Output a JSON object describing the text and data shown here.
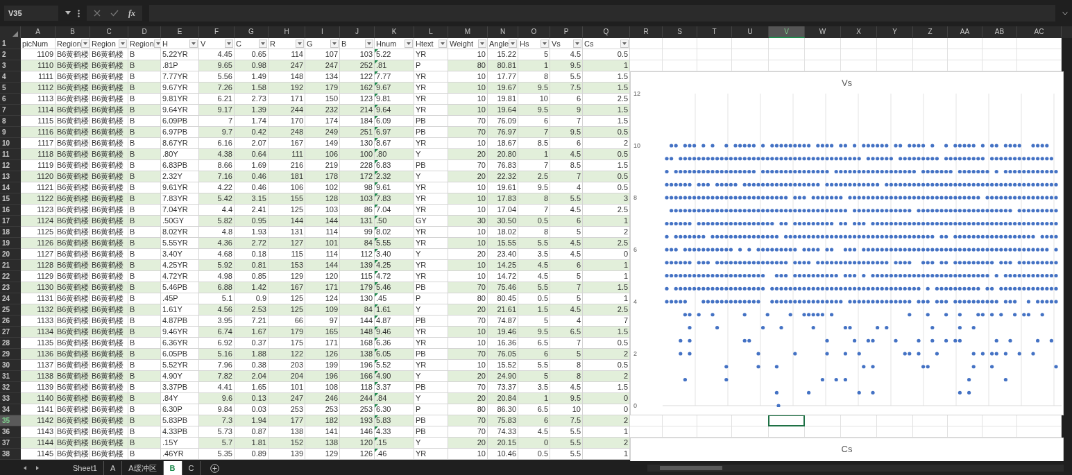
{
  "name_box": {
    "value": "V35"
  },
  "formula_bar": {
    "function_label": "fx"
  },
  "columns": [
    {
      "letter": "A",
      "selected": false
    },
    {
      "letter": "B",
      "selected": false
    },
    {
      "letter": "C",
      "selected": false
    },
    {
      "letter": "D",
      "selected": false
    },
    {
      "letter": "E",
      "selected": false
    },
    {
      "letter": "F",
      "selected": false
    },
    {
      "letter": "G",
      "selected": false
    },
    {
      "letter": "H",
      "selected": false
    },
    {
      "letter": "I",
      "selected": false
    },
    {
      "letter": "J",
      "selected": false
    },
    {
      "letter": "K",
      "selected": false
    },
    {
      "letter": "L",
      "selected": false
    },
    {
      "letter": "M",
      "selected": false
    },
    {
      "letter": "N",
      "selected": false
    },
    {
      "letter": "O",
      "selected": false
    },
    {
      "letter": "P",
      "selected": false
    },
    {
      "letter": "Q",
      "selected": false
    },
    {
      "letter": "R",
      "selected": false
    },
    {
      "letter": "S",
      "selected": false
    },
    {
      "letter": "T",
      "selected": false
    },
    {
      "letter": "U",
      "selected": false
    },
    {
      "letter": "V",
      "selected": true
    },
    {
      "letter": "W",
      "selected": false
    },
    {
      "letter": "X",
      "selected": false
    },
    {
      "letter": "Y",
      "selected": false
    },
    {
      "letter": "Z",
      "selected": false
    },
    {
      "letter": "AA",
      "selected": false
    },
    {
      "letter": "AB",
      "selected": false
    },
    {
      "letter": "AC",
      "selected": false
    }
  ],
  "header_row": {
    "num": "1",
    "headers": [
      {
        "text": "picNum",
        "filter": false,
        "kind": "number",
        "banded": true
      },
      {
        "text": "Region",
        "filter": true,
        "kind": "text",
        "banded": true
      },
      {
        "text": "Region",
        "filter": true,
        "kind": "text",
        "banded": true
      },
      {
        "text": "Region",
        "filter": true,
        "kind": "text",
        "banded": true
      },
      {
        "text": "H",
        "filter": true,
        "kind": "text",
        "banded": false
      },
      {
        "text": "V",
        "filter": true,
        "kind": "number",
        "banded": true
      },
      {
        "text": "C",
        "filter": true,
        "kind": "number",
        "banded": true
      },
      {
        "text": "R",
        "filter": true,
        "kind": "number",
        "banded": true
      },
      {
        "text": "G",
        "filter": true,
        "kind": "number",
        "banded": true
      },
      {
        "text": "B",
        "filter": true,
        "kind": "number",
        "banded": true
      },
      {
        "text": "Hnum",
        "filter": true,
        "kind": "number_as_text",
        "banded": true
      },
      {
        "text": "Htext",
        "filter": true,
        "kind": "text",
        "banded": false
      },
      {
        "text": "Weight",
        "filter": true,
        "kind": "number",
        "banded": true
      },
      {
        "text": "Angle",
        "filter": true,
        "kind": "number",
        "banded": true
      },
      {
        "text": "Hs",
        "filter": true,
        "kind": "number",
        "banded": true
      },
      {
        "text": "Vs",
        "filter": true,
        "kind": "number",
        "banded": true
      },
      {
        "text": "Cs",
        "filter": true,
        "kind": "number",
        "banded": true
      }
    ]
  },
  "rows": [
    {
      "num": "2",
      "selected": false,
      "cells": [
        "1109",
        "B6黄鹤楼",
        "B6黄鹤楼",
        "B",
        "5.22YR",
        "4.45",
        "0.65",
        "114",
        "107",
        "103",
        "5.22",
        "YR",
        "10",
        "15.22",
        "5",
        "4.5",
        "0.5"
      ]
    },
    {
      "num": "3",
      "selected": false,
      "cells": [
        "1110",
        "B6黄鹤楼",
        "B6黄鹤楼",
        "B",
        ".81P",
        "9.65",
        "0.98",
        "247",
        "247",
        "252",
        ".81",
        "P",
        "80",
        "80.81",
        "1",
        "9.5",
        "1"
      ]
    },
    {
      "num": "4",
      "selected": false,
      "cells": [
        "1111",
        "B6黄鹤楼",
        "B6黄鹤楼",
        "B",
        "7.77YR",
        "5.56",
        "1.49",
        "148",
        "134",
        "122",
        "7.77",
        "YR",
        "10",
        "17.77",
        "8",
        "5.5",
        "1.5"
      ]
    },
    {
      "num": "5",
      "selected": false,
      "cells": [
        "1112",
        "B6黄鹤楼",
        "B6黄鹤楼",
        "B",
        "9.67YR",
        "7.26",
        "1.58",
        "192",
        "179",
        "162",
        "9.67",
        "YR",
        "10",
        "19.67",
        "9.5",
        "7.5",
        "1.5"
      ]
    },
    {
      "num": "6",
      "selected": false,
      "cells": [
        "1113",
        "B6黄鹤楼",
        "B6黄鹤楼",
        "B",
        "9.81YR",
        "6.21",
        "2.73",
        "171",
        "150",
        "123",
        "9.81",
        "YR",
        "10",
        "19.81",
        "10",
        "6",
        "2.5"
      ]
    },
    {
      "num": "7",
      "selected": false,
      "cells": [
        "1114",
        "B6黄鹤楼",
        "B6黄鹤楼",
        "B",
        "9.64YR",
        "9.17",
        "1.39",
        "244",
        "232",
        "214",
        "9.64",
        "YR",
        "10",
        "19.64",
        "9.5",
        "9",
        "1.5"
      ]
    },
    {
      "num": "8",
      "selected": false,
      "cells": [
        "1115",
        "B6黄鹤楼",
        "B6黄鹤楼",
        "B",
        "6.09PB",
        "7",
        "1.74",
        "170",
        "174",
        "184",
        "6.09",
        "PB",
        "70",
        "76.09",
        "6",
        "7",
        "1.5"
      ]
    },
    {
      "num": "9",
      "selected": false,
      "cells": [
        "1116",
        "B6黄鹤楼",
        "B6黄鹤楼",
        "B",
        "6.97PB",
        "9.7",
        "0.42",
        "248",
        "249",
        "251",
        "6.97",
        "PB",
        "70",
        "76.97",
        "7",
        "9.5",
        "0.5"
      ]
    },
    {
      "num": "10",
      "selected": false,
      "cells": [
        "1117",
        "B6黄鹤楼",
        "B6黄鹤楼",
        "B",
        "8.67YR",
        "6.16",
        "2.07",
        "167",
        "149",
        "130",
        "8.67",
        "YR",
        "10",
        "18.67",
        "8.5",
        "6",
        "2"
      ]
    },
    {
      "num": "11",
      "selected": false,
      "cells": [
        "1118",
        "B6黄鹤楼",
        "B6黄鹤楼",
        "B",
        ".80Y",
        "4.38",
        "0.64",
        "111",
        "106",
        "100",
        ".80",
        "Y",
        "20",
        "20.80",
        "1",
        "4.5",
        "0.5"
      ]
    },
    {
      "num": "12",
      "selected": false,
      "cells": [
        "1119",
        "B6黄鹤楼",
        "B6黄鹤楼",
        "B",
        "6.83PB",
        "8.66",
        "1.69",
        "216",
        "219",
        "228",
        "6.83",
        "PB",
        "70",
        "76.83",
        "7",
        "8.5",
        "1.5"
      ]
    },
    {
      "num": "13",
      "selected": false,
      "cells": [
        "1120",
        "B6黄鹤楼",
        "B6黄鹤楼",
        "B",
        "2.32Y",
        "7.16",
        "0.46",
        "181",
        "178",
        "172",
        "2.32",
        "Y",
        "20",
        "22.32",
        "2.5",
        "7",
        "0.5"
      ]
    },
    {
      "num": "14",
      "selected": false,
      "cells": [
        "1121",
        "B6黄鹤楼",
        "B6黄鹤楼",
        "B",
        "9.61YR",
        "4.22",
        "0.46",
        "106",
        "102",
        "98",
        "9.61",
        "YR",
        "10",
        "19.61",
        "9.5",
        "4",
        "0.5"
      ]
    },
    {
      "num": "15",
      "selected": false,
      "cells": [
        "1122",
        "B6黄鹤楼",
        "B6黄鹤楼",
        "B",
        "7.83YR",
        "5.42",
        "3.15",
        "155",
        "128",
        "103",
        "7.83",
        "YR",
        "10",
        "17.83",
        "8",
        "5.5",
        "3"
      ]
    },
    {
      "num": "16",
      "selected": false,
      "cells": [
        "1123",
        "B6黄鹤楼",
        "B6黄鹤楼",
        "B",
        "7.04YR",
        "4.4",
        "2.41",
        "125",
        "103",
        "86",
        "7.04",
        "YR",
        "10",
        "17.04",
        "7",
        "4.5",
        "2.5"
      ]
    },
    {
      "num": "17",
      "selected": false,
      "cells": [
        "1124",
        "B6黄鹤楼",
        "B6黄鹤楼",
        "B",
        ".50GY",
        "5.82",
        "0.95",
        "144",
        "144",
        "131",
        ".50",
        "GY",
        "30",
        "30.50",
        "0.5",
        "6",
        "1"
      ]
    },
    {
      "num": "18",
      "selected": false,
      "cells": [
        "1125",
        "B6黄鹤楼",
        "B6黄鹤楼",
        "B",
        "8.02YR",
        "4.8",
        "1.93",
        "131",
        "114",
        "99",
        "8.02",
        "YR",
        "10",
        "18.02",
        "8",
        "5",
        "2"
      ]
    },
    {
      "num": "19",
      "selected": false,
      "cells": [
        "1126",
        "B6黄鹤楼",
        "B6黄鹤楼",
        "B",
        "5.55YR",
        "4.36",
        "2.72",
        "127",
        "101",
        "84",
        "5.55",
        "YR",
        "10",
        "15.55",
        "5.5",
        "4.5",
        "2.5"
      ]
    },
    {
      "num": "20",
      "selected": false,
      "cells": [
        "1127",
        "B6黄鹤楼",
        "B6黄鹤楼",
        "B",
        "3.40Y",
        "4.68",
        "0.18",
        "115",
        "114",
        "112",
        "3.40",
        "Y",
        "20",
        "23.40",
        "3.5",
        "4.5",
        "0"
      ]
    },
    {
      "num": "21",
      "selected": false,
      "cells": [
        "1128",
        "B6黄鹤楼",
        "B6黄鹤楼",
        "B",
        "4.25YR",
        "5.92",
        "0.81",
        "153",
        "144",
        "139",
        "4.25",
        "YR",
        "10",
        "14.25",
        "4.5",
        "6",
        "1"
      ]
    },
    {
      "num": "22",
      "selected": false,
      "cells": [
        "1129",
        "B6黄鹤楼",
        "B6黄鹤楼",
        "B",
        "4.72YR",
        "4.98",
        "0.85",
        "129",
        "120",
        "115",
        "4.72",
        "YR",
        "10",
        "14.72",
        "4.5",
        "5",
        "1"
      ]
    },
    {
      "num": "23",
      "selected": false,
      "cells": [
        "1130",
        "B6黄鹤楼",
        "B6黄鹤楼",
        "B",
        "5.46PB",
        "6.88",
        "1.42",
        "167",
        "171",
        "179",
        "5.46",
        "PB",
        "70",
        "75.46",
        "5.5",
        "7",
        "1.5"
      ]
    },
    {
      "num": "24",
      "selected": false,
      "cells": [
        "1131",
        "B6黄鹤楼",
        "B6黄鹤楼",
        "B",
        ".45P",
        "5.1",
        "0.9",
        "125",
        "124",
        "130",
        ".45",
        "P",
        "80",
        "80.45",
        "0.5",
        "5",
        "1"
      ]
    },
    {
      "num": "25",
      "selected": false,
      "cells": [
        "1132",
        "B6黄鹤楼",
        "B6黄鹤楼",
        "B",
        "1.61Y",
        "4.56",
        "2.53",
        "125",
        "109",
        "84",
        "1.61",
        "Y",
        "20",
        "21.61",
        "1.5",
        "4.5",
        "2.5"
      ]
    },
    {
      "num": "26",
      "selected": false,
      "cells": [
        "1133",
        "B6黄鹤楼",
        "B6黄鹤楼",
        "B",
        "4.87PB",
        "3.95",
        "7.21",
        "66",
        "97",
        "144",
        "4.87",
        "PB",
        "70",
        "74.87",
        "5",
        "4",
        "7"
      ]
    },
    {
      "num": "27",
      "selected": false,
      "cells": [
        "1134",
        "B6黄鹤楼",
        "B6黄鹤楼",
        "B",
        "9.46YR",
        "6.74",
        "1.67",
        "179",
        "165",
        "148",
        "9.46",
        "YR",
        "10",
        "19.46",
        "9.5",
        "6.5",
        "1.5"
      ]
    },
    {
      "num": "28",
      "selected": false,
      "cells": [
        "1135",
        "B6黄鹤楼",
        "B6黄鹤楼",
        "B",
        "6.36YR",
        "6.92",
        "0.37",
        "175",
        "171",
        "168",
        "6.36",
        "YR",
        "10",
        "16.36",
        "6.5",
        "7",
        "0.5"
      ]
    },
    {
      "num": "29",
      "selected": false,
      "cells": [
        "1136",
        "B6黄鹤楼",
        "B6黄鹤楼",
        "B",
        "6.05PB",
        "5.16",
        "1.88",
        "122",
        "126",
        "138",
        "6.05",
        "PB",
        "70",
        "76.05",
        "6",
        "5",
        "2"
      ]
    },
    {
      "num": "30",
      "selected": false,
      "cells": [
        "1137",
        "B6黄鹤楼",
        "B6黄鹤楼",
        "B",
        "5.52YR",
        "7.96",
        "0.38",
        "203",
        "199",
        "196",
        "5.52",
        "YR",
        "10",
        "15.52",
        "5.5",
        "8",
        "0.5"
      ]
    },
    {
      "num": "31",
      "selected": false,
      "cells": [
        "1138",
        "B6黄鹤楼",
        "B6黄鹤楼",
        "B",
        "4.90Y",
        "7.82",
        "2.04",
        "204",
        "196",
        "166",
        "4.90",
        "Y",
        "20",
        "24.90",
        "5",
        "8",
        "2"
      ]
    },
    {
      "num": "32",
      "selected": false,
      "cells": [
        "1139",
        "B6黄鹤楼",
        "B6黄鹤楼",
        "B",
        "3.37PB",
        "4.41",
        "1.65",
        "101",
        "108",
        "118",
        "3.37",
        "PB",
        "70",
        "73.37",
        "3.5",
        "4.5",
        "1.5"
      ]
    },
    {
      "num": "33",
      "selected": false,
      "cells": [
        "1140",
        "B6黄鹤楼",
        "B6黄鹤楼",
        "B",
        ".84Y",
        "9.6",
        "0.13",
        "247",
        "246",
        "244",
        ".84",
        "Y",
        "20",
        "20.84",
        "1",
        "9.5",
        "0"
      ]
    },
    {
      "num": "34",
      "selected": false,
      "cells": [
        "1141",
        "B6黄鹤楼",
        "B6黄鹤楼",
        "B",
        "6.30P",
        "9.84",
        "0.03",
        "253",
        "253",
        "253",
        "6.30",
        "P",
        "80",
        "86.30",
        "6.5",
        "10",
        "0"
      ]
    },
    {
      "num": "35",
      "selected": true,
      "cells": [
        "1142",
        "B6黄鹤楼",
        "B6黄鹤楼",
        "B",
        "5.83PB",
        "7.3",
        "1.94",
        "177",
        "182",
        "193",
        "5.83",
        "PB",
        "70",
        "75.83",
        "6",
        "7.5",
        "2"
      ]
    },
    {
      "num": "36",
      "selected": false,
      "cells": [
        "1143",
        "B6黄鹤楼",
        "B6黄鹤楼",
        "B",
        "4.33PB",
        "5.73",
        "0.87",
        "138",
        "141",
        "146",
        "4.33",
        "PB",
        "70",
        "74.33",
        "4.5",
        "5.5",
        "1"
      ]
    },
    {
      "num": "37",
      "selected": false,
      "cells": [
        "1144",
        "B6黄鹤楼",
        "B6黄鹤楼",
        "B",
        ".15Y",
        "5.7",
        "1.81",
        "152",
        "138",
        "120",
        ".15",
        "Y",
        "20",
        "20.15",
        "0",
        "5.5",
        "2"
      ]
    },
    {
      "num": "38",
      "selected": false,
      "cells": [
        "1145",
        "B6黄鹤楼",
        "B6黄鹤楼",
        "B",
        ".46YR",
        "5.35",
        "0.89",
        "139",
        "129",
        "126",
        ".46",
        "YR",
        "10",
        "10.46",
        "0.5",
        "5.5",
        "1"
      ]
    }
  ],
  "charts": [
    {
      "title": "Vs",
      "y_tick_labels": [
        "12",
        "10",
        "8",
        "6",
        "4",
        "2",
        "0"
      ]
    },
    {
      "title": "Cs"
    }
  ],
  "sheet_tabs": [
    {
      "label": "Sheet1",
      "selected": false
    },
    {
      "label": "A",
      "selected": false
    },
    {
      "label": "A缓冲区",
      "selected": false
    },
    {
      "label": "B",
      "selected": true
    },
    {
      "label": "C",
      "selected": false
    }
  ]
}
